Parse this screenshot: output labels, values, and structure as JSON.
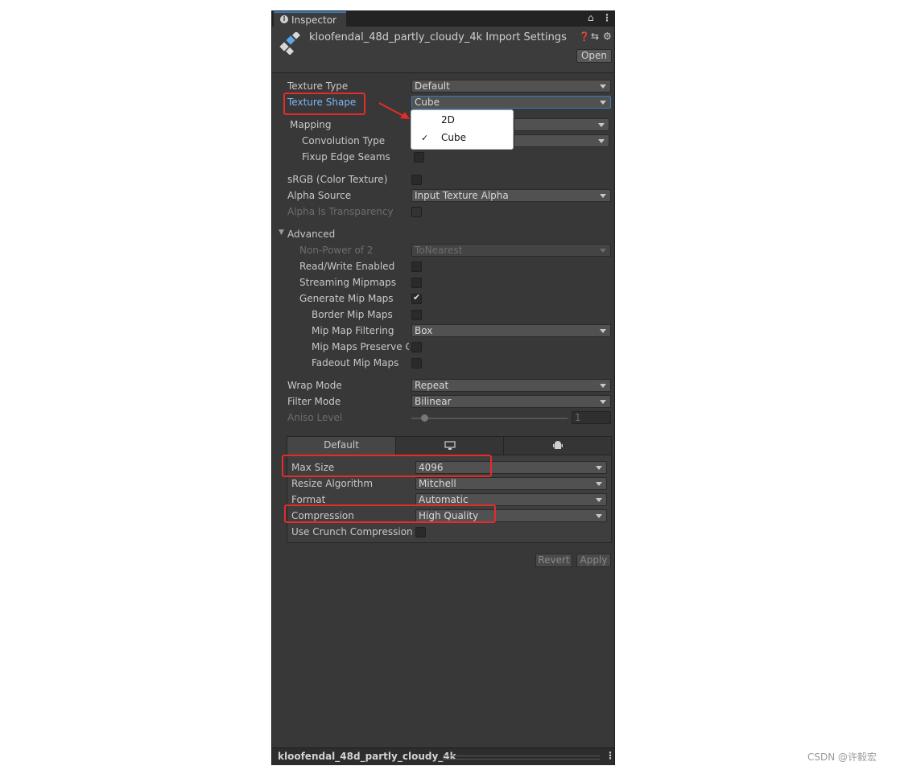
{
  "window": {
    "tab_label": "Inspector",
    "asset_title": "kloofendal_48d_partly_cloudy_4k Import Settings",
    "open_button": "Open",
    "header_icons": [
      "help-icon",
      "preset-icon",
      "settings-icon"
    ]
  },
  "fields": {
    "texture_type": {
      "label": "Texture Type",
      "value": "Default"
    },
    "texture_shape": {
      "label": "Texture Shape",
      "value": "Cube"
    },
    "mapping": {
      "label": "Mapping"
    },
    "convolution_type": {
      "label": "Convolution Type"
    },
    "fixup_edge_seams": {
      "label": "Fixup Edge Seams",
      "checked": false
    },
    "srgb": {
      "label": "sRGB (Color Texture)",
      "checked": false
    },
    "alpha_source": {
      "label": "Alpha Source",
      "value": "Input Texture Alpha"
    },
    "alpha_is_transparency": {
      "label": "Alpha Is Transparency",
      "checked": false
    },
    "advanced": {
      "label": "Advanced",
      "expanded": true
    },
    "non_power_of_2": {
      "label": "Non-Power of 2",
      "value": "ToNearest"
    },
    "read_write": {
      "label": "Read/Write Enabled",
      "checked": false
    },
    "streaming_mipmaps": {
      "label": "Streaming Mipmaps",
      "checked": false
    },
    "generate_mip_maps": {
      "label": "Generate Mip Maps",
      "checked": true
    },
    "border_mip_maps": {
      "label": "Border Mip Maps",
      "checked": false
    },
    "mip_map_filtering": {
      "label": "Mip Map Filtering",
      "value": "Box"
    },
    "mip_maps_preserve": {
      "label": "Mip Maps Preserve C",
      "checked": false
    },
    "fadeout_mip_maps": {
      "label": "Fadeout Mip Maps",
      "checked": false
    },
    "wrap_mode": {
      "label": "Wrap Mode",
      "value": "Repeat"
    },
    "filter_mode": {
      "label": "Filter Mode",
      "value": "Bilinear"
    },
    "aniso_level": {
      "label": "Aniso Level",
      "value": "1"
    }
  },
  "dropdown_popup": {
    "options": [
      {
        "label": "2D",
        "selected": false
      },
      {
        "label": "Cube",
        "selected": true
      }
    ],
    "check_mark": "✓"
  },
  "platform": {
    "tabs": [
      {
        "label": "Default",
        "icon": null
      },
      {
        "label": "",
        "icon": "monitor-icon"
      },
      {
        "label": "",
        "icon": "android-icon"
      }
    ],
    "max_size": {
      "label": "Max Size",
      "value": "4096"
    },
    "resize_algorithm": {
      "label": "Resize Algorithm",
      "value": "Mitchell"
    },
    "format": {
      "label": "Format",
      "value": "Automatic"
    },
    "compression": {
      "label": "Compression",
      "value": "High Quality"
    },
    "use_crunch": {
      "label": "Use Crunch Compression",
      "checked": false
    }
  },
  "footer": {
    "revert_button": "Revert",
    "apply_button": "Apply",
    "status_text": "kloofendal_48d_partly_cloudy_4k"
  },
  "watermark": "CSDN @许毅宏",
  "colors": {
    "highlight_red": "#e52b2b",
    "selected_label_blue": "#7bb7f3",
    "panel_bg": "#383838"
  }
}
